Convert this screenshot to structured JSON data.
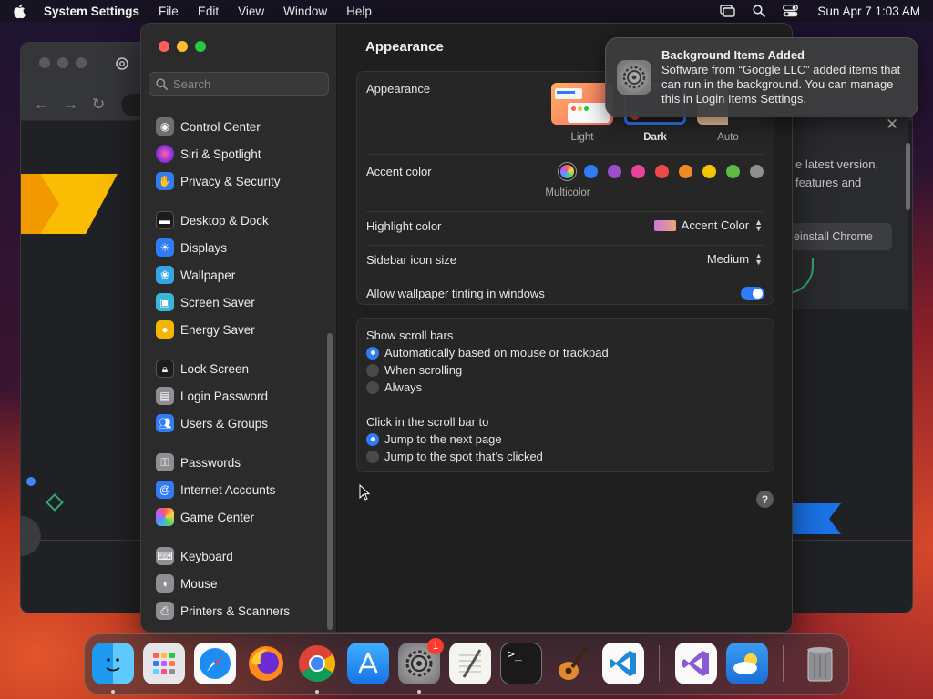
{
  "menubar": {
    "app_name": "System Settings",
    "menus": [
      "File",
      "Edit",
      "View",
      "Window",
      "Help"
    ],
    "clock": "Sun Apr 7  1:03 AM"
  },
  "chrome_window": {
    "update_text_line1": "e latest version,",
    "update_text_line2": "features and",
    "reinstall_label": "einstall Chrome",
    "close_glyph": "✕"
  },
  "sidebar": {
    "search_placeholder": "Search",
    "items": [
      {
        "label": "Control Center",
        "icon": "control-center-icon",
        "color": "#6e6e73"
      },
      {
        "label": "Siri & Spotlight",
        "icon": "siri-icon",
        "color": "#b43bd6"
      },
      {
        "label": "Privacy & Security",
        "icon": "privacy-hand-icon",
        "color": "#2f7cf6"
      },
      {
        "label": "Desktop & Dock",
        "icon": "desktop-dock-icon",
        "color": "#1c1c1e"
      },
      {
        "label": "Displays",
        "icon": "displays-icon",
        "color": "#2f7cf6"
      },
      {
        "label": "Wallpaper",
        "icon": "wallpaper-icon",
        "color": "#34a4e8"
      },
      {
        "label": "Screen Saver",
        "icon": "screen-saver-icon",
        "color": "#3ab6d9"
      },
      {
        "label": "Energy Saver",
        "icon": "energy-saver-icon",
        "color": "#f5b400"
      },
      {
        "label": "Lock Screen",
        "icon": "lock-screen-icon",
        "color": "#1c1c1e"
      },
      {
        "label": "Login Password",
        "icon": "login-password-icon",
        "color": "#8e8e93"
      },
      {
        "label": "Users & Groups",
        "icon": "users-groups-icon",
        "color": "#2f7cf6"
      },
      {
        "label": "Passwords",
        "icon": "passwords-key-icon",
        "color": "#8e8e93"
      },
      {
        "label": "Internet Accounts",
        "icon": "internet-accounts-icon",
        "color": "#2f7cf6"
      },
      {
        "label": "Game Center",
        "icon": "game-center-icon",
        "color": "#e8e8e8"
      },
      {
        "label": "Keyboard",
        "icon": "keyboard-icon",
        "color": "#8e8e93"
      },
      {
        "label": "Mouse",
        "icon": "mouse-icon",
        "color": "#8e8e93"
      },
      {
        "label": "Printers & Scanners",
        "icon": "printer-icon",
        "color": "#8e8e93"
      }
    ]
  },
  "main": {
    "title": "Appearance",
    "appearance": {
      "label": "Appearance",
      "options": [
        "Light",
        "Dark",
        "Auto"
      ],
      "selected": "Dark"
    },
    "accent": {
      "label": "Accent color",
      "selected_name": "Multicolor",
      "colors": [
        "#2f7cf6",
        "#9b4dca",
        "#e8459a",
        "#ec4a4a",
        "#f08a24",
        "#f5c400",
        "#5cb946",
        "#8e8e93"
      ]
    },
    "highlight": {
      "label": "Highlight color",
      "value": "Accent Color"
    },
    "sidebar_icon_size": {
      "label": "Sidebar icon size",
      "value": "Medium"
    },
    "wallpaper_tinting": {
      "label": "Allow wallpaper tinting in windows",
      "enabled": true
    },
    "scroll_bars": {
      "label": "Show scroll bars",
      "options": [
        "Automatically based on mouse or trackpad",
        "When scrolling",
        "Always"
      ],
      "selected": "Automatically based on mouse or trackpad"
    },
    "click_scroll": {
      "label": "Click in the scroll bar to",
      "options": [
        "Jump to the next page",
        "Jump to the spot that’s clicked"
      ],
      "selected": "Jump to the next page"
    },
    "help_label": "?"
  },
  "notification": {
    "title": "Background Items Added",
    "body": "Software from “Google LLC” added items that can run in the background. You can manage this in Login Items Settings."
  },
  "dock": {
    "apps": [
      {
        "name": "Finder",
        "icon": "finder-icon",
        "running": true
      },
      {
        "name": "Launchpad",
        "icon": "launchpad-icon",
        "running": false
      },
      {
        "name": "Safari",
        "icon": "safari-icon",
        "running": false
      },
      {
        "name": "Firefox",
        "icon": "firefox-icon",
        "running": false
      },
      {
        "name": "Google Chrome",
        "icon": "chrome-icon",
        "running": true
      },
      {
        "name": "App Store",
        "icon": "app-store-icon",
        "running": false
      },
      {
        "name": "System Settings",
        "icon": "system-settings-icon",
        "running": true
      },
      {
        "name": "TextEdit",
        "icon": "textedit-icon",
        "running": false
      },
      {
        "name": "Terminal",
        "icon": "terminal-icon",
        "running": false
      },
      {
        "name": "GarageBand",
        "icon": "garageband-icon",
        "running": false
      },
      {
        "name": "Visual Studio Code",
        "icon": "vscode-icon",
        "running": false
      },
      {
        "name": "Visual Studio",
        "icon": "visual-studio-icon",
        "running": false
      },
      {
        "name": "Weather",
        "icon": "weather-icon",
        "running": false
      },
      {
        "name": "Trash",
        "icon": "trash-icon",
        "running": false
      }
    ],
    "settings_badge": "1"
  }
}
